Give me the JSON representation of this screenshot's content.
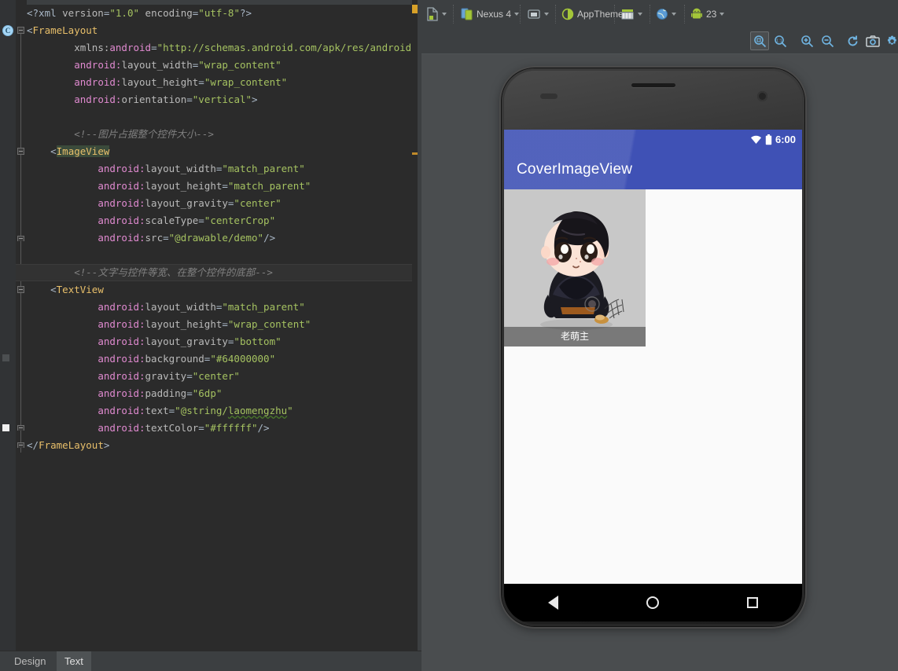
{
  "editor": {
    "tabs": [
      {
        "label": "Design",
        "selected": false
      },
      {
        "label": "Text",
        "selected": true
      }
    ],
    "gutter": {
      "class_badge": "C"
    },
    "code_lines": [
      {
        "indent": 0,
        "tokens": [
          {
            "t": "punct",
            "s": "<?xml "
          },
          {
            "t": "attr",
            "s": "version"
          },
          {
            "t": "punct",
            "s": "="
          },
          {
            "t": "val",
            "s": "\"1.0\""
          },
          {
            "t": "plain",
            "s": " "
          },
          {
            "t": "attr",
            "s": "encoding"
          },
          {
            "t": "punct",
            "s": "="
          },
          {
            "t": "val",
            "s": "\"utf-8\""
          },
          {
            "t": "punct",
            "s": "?>"
          }
        ]
      },
      {
        "indent": 0,
        "tokens": [
          {
            "t": "punct",
            "s": "<"
          },
          {
            "t": "tag",
            "s": "FrameLayout"
          }
        ]
      },
      {
        "indent": 4,
        "tokens": [
          {
            "t": "attr",
            "s": "xmlns:"
          },
          {
            "t": "ns",
            "s": "android"
          },
          {
            "t": "punct",
            "s": "="
          },
          {
            "t": "val",
            "s": "\"http://schemas.android.com/apk/res/android\""
          }
        ]
      },
      {
        "indent": 4,
        "tokens": [
          {
            "t": "ns",
            "s": "android:"
          },
          {
            "t": "attr",
            "s": "layout_width"
          },
          {
            "t": "punct",
            "s": "="
          },
          {
            "t": "val",
            "s": "\"wrap_content\""
          }
        ]
      },
      {
        "indent": 4,
        "tokens": [
          {
            "t": "ns",
            "s": "android:"
          },
          {
            "t": "attr",
            "s": "layout_height"
          },
          {
            "t": "punct",
            "s": "="
          },
          {
            "t": "val",
            "s": "\"wrap_content\""
          }
        ]
      },
      {
        "indent": 4,
        "tokens": [
          {
            "t": "ns",
            "s": "android:"
          },
          {
            "t": "attr",
            "s": "orientation"
          },
          {
            "t": "punct",
            "s": "="
          },
          {
            "t": "val",
            "s": "\"vertical\""
          },
          {
            "t": "punct",
            "s": ">"
          }
        ]
      },
      {
        "indent": 0,
        "tokens": []
      },
      {
        "indent": 4,
        "tokens": [
          {
            "t": "cmt",
            "s": "<!--图片占据整个控件大小-->"
          }
        ]
      },
      {
        "indent": 2,
        "tokens": [
          {
            "t": "punct",
            "s": "<"
          },
          {
            "t": "tag-hl",
            "s": "ImageView"
          }
        ]
      },
      {
        "indent": 6,
        "tokens": [
          {
            "t": "ns",
            "s": "android:"
          },
          {
            "t": "attr",
            "s": "layout_width"
          },
          {
            "t": "punct",
            "s": "="
          },
          {
            "t": "val",
            "s": "\"match_parent\""
          }
        ]
      },
      {
        "indent": 6,
        "tokens": [
          {
            "t": "ns",
            "s": "android:"
          },
          {
            "t": "attr",
            "s": "layout_height"
          },
          {
            "t": "punct",
            "s": "="
          },
          {
            "t": "val",
            "s": "\"match_parent\""
          }
        ]
      },
      {
        "indent": 6,
        "tokens": [
          {
            "t": "ns",
            "s": "android:"
          },
          {
            "t": "attr",
            "s": "layout_gravity"
          },
          {
            "t": "punct",
            "s": "="
          },
          {
            "t": "val",
            "s": "\"center\""
          }
        ]
      },
      {
        "indent": 6,
        "tokens": [
          {
            "t": "ns",
            "s": "android:"
          },
          {
            "t": "attr",
            "s": "scaleType"
          },
          {
            "t": "punct",
            "s": "="
          },
          {
            "t": "val",
            "s": "\"centerCrop\""
          }
        ]
      },
      {
        "indent": 6,
        "tokens": [
          {
            "t": "ns",
            "s": "android:"
          },
          {
            "t": "attr",
            "s": "src"
          },
          {
            "t": "punct",
            "s": "="
          },
          {
            "t": "val",
            "s": "\"@drawable/demo\""
          },
          {
            "t": "punct",
            "s": "/>"
          }
        ]
      },
      {
        "indent": 0,
        "tokens": []
      },
      {
        "indent": 4,
        "tokens": [
          {
            "t": "cmt",
            "s": "<!--文字与控件等宽、在整个控件的底部-->"
          }
        ]
      },
      {
        "indent": 2,
        "tokens": [
          {
            "t": "punct",
            "s": "<"
          },
          {
            "t": "tag",
            "s": "TextView"
          }
        ]
      },
      {
        "indent": 6,
        "tokens": [
          {
            "t": "ns",
            "s": "android:"
          },
          {
            "t": "attr",
            "s": "layout_width"
          },
          {
            "t": "punct",
            "s": "="
          },
          {
            "t": "val",
            "s": "\"match_parent\""
          }
        ]
      },
      {
        "indent": 6,
        "tokens": [
          {
            "t": "ns",
            "s": "android:"
          },
          {
            "t": "attr",
            "s": "layout_height"
          },
          {
            "t": "punct",
            "s": "="
          },
          {
            "t": "val",
            "s": "\"wrap_content\""
          }
        ]
      },
      {
        "indent": 6,
        "tokens": [
          {
            "t": "ns",
            "s": "android:"
          },
          {
            "t": "attr",
            "s": "layout_gravity"
          },
          {
            "t": "punct",
            "s": "="
          },
          {
            "t": "val",
            "s": "\"bottom\""
          }
        ]
      },
      {
        "indent": 6,
        "tokens": [
          {
            "t": "ns",
            "s": "android:"
          },
          {
            "t": "attr",
            "s": "background"
          },
          {
            "t": "punct",
            "s": "="
          },
          {
            "t": "val",
            "s": "\"#64000000\""
          }
        ]
      },
      {
        "indent": 6,
        "tokens": [
          {
            "t": "ns",
            "s": "android:"
          },
          {
            "t": "attr",
            "s": "gravity"
          },
          {
            "t": "punct",
            "s": "="
          },
          {
            "t": "val",
            "s": "\"center\""
          }
        ]
      },
      {
        "indent": 6,
        "tokens": [
          {
            "t": "ns",
            "s": "android:"
          },
          {
            "t": "attr",
            "s": "padding"
          },
          {
            "t": "punct",
            "s": "="
          },
          {
            "t": "val",
            "s": "\"6dp\""
          }
        ]
      },
      {
        "indent": 6,
        "tokens": [
          {
            "t": "ns",
            "s": "android:"
          },
          {
            "t": "attr",
            "s": "text"
          },
          {
            "t": "punct",
            "s": "="
          },
          {
            "t": "val",
            "s": "\"@string/"
          },
          {
            "t": "squiggle",
            "s": "laomengzhu"
          },
          {
            "t": "val",
            "s": "\""
          }
        ]
      },
      {
        "indent": 6,
        "tokens": [
          {
            "t": "ns",
            "s": "android:"
          },
          {
            "t": "attr",
            "s": "textColor"
          },
          {
            "t": "punct",
            "s": "="
          },
          {
            "t": "val",
            "s": "\"#ffffff\""
          },
          {
            "t": "punct",
            "s": "/>"
          }
        ]
      },
      {
        "indent": 0,
        "tokens": [
          {
            "t": "punct",
            "s": "</"
          },
          {
            "t": "tag",
            "s": "FrameLayout"
          },
          {
            "t": "punct",
            "s": ">"
          }
        ]
      }
    ]
  },
  "preview": {
    "toolbar": [
      {
        "name": "file-config-dropdown",
        "label": "",
        "icon": "document-icon"
      },
      {
        "name": "device-dropdown",
        "label": "Nexus 4",
        "icon": "device-icon"
      },
      {
        "name": "orientation-dropdown",
        "label": "",
        "icon": "orientation-icon"
      },
      {
        "name": "theme-dropdown",
        "label": "AppTheme",
        "icon": "theme-icon"
      },
      {
        "name": "activity-dropdown",
        "label": "",
        "icon": "layout-icon"
      },
      {
        "name": "locale-dropdown",
        "label": "",
        "icon": "globe-icon"
      },
      {
        "name": "api-level-dropdown",
        "label": "23",
        "icon": "android-icon"
      }
    ],
    "zoom_buttons": [
      {
        "name": "zoom-to-fit-button",
        "icon": "zoom-fit-icon",
        "active": true
      },
      {
        "name": "zoom-actual-size-button",
        "icon": "zoom-1to1-icon",
        "active": false
      },
      {
        "name": "zoom-in-button",
        "icon": "zoom-in-icon",
        "active": false
      },
      {
        "name": "zoom-out-button",
        "icon": "zoom-out-icon",
        "active": false
      },
      {
        "name": "refresh-button",
        "icon": "refresh-icon",
        "active": false
      },
      {
        "name": "screenshot-button",
        "icon": "camera-icon",
        "active": false
      },
      {
        "name": "settings-button",
        "icon": "gear-icon",
        "active": false
      }
    ],
    "device": {
      "model": "Nexus 4",
      "status_bar": {
        "time": "6:00",
        "wifi": "wifi-icon",
        "battery": "battery-icon"
      },
      "app_bar": {
        "title": "CoverImageView",
        "color": "#3f51b5"
      },
      "cover_widget": {
        "caption": "老萌主",
        "caption_bg": "#64000000",
        "caption_color": "#ffffff",
        "image_bg": "#c8c8c8"
      },
      "nav_bar": {
        "back": "back-triangle-icon",
        "home": "home-circle-icon",
        "recents": "recents-square-icon"
      }
    }
  }
}
